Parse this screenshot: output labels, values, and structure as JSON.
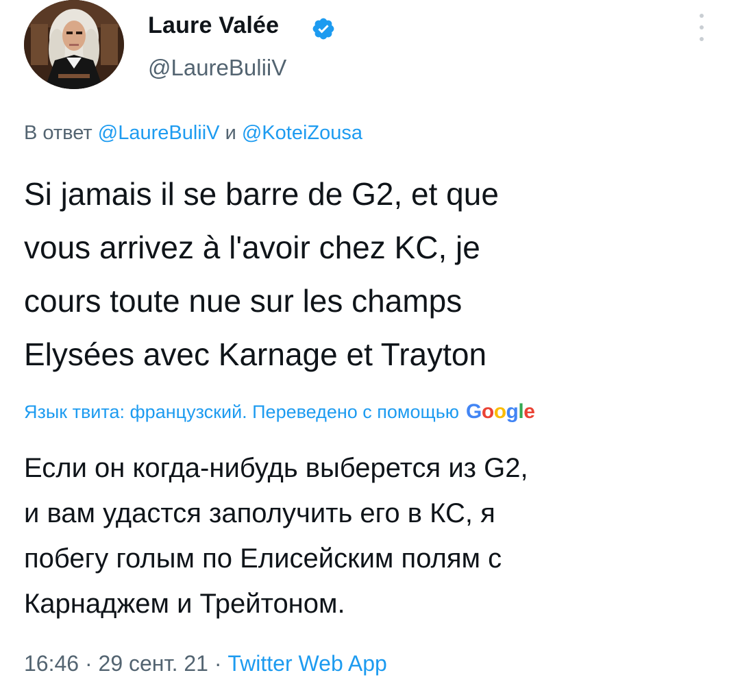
{
  "author": {
    "display_name": "Laure Valée",
    "username": "@LaureBuliiV",
    "verified": true,
    "avatar_icon": "profile-photo"
  },
  "reply_context": {
    "prefix": "В ответ",
    "mention_1": "@LaureBuliiV",
    "conjunction": "и",
    "mention_2": "@KoteiZousa"
  },
  "tweet_lines": [
    "Si jamais il se barre de G2, et que",
    "vous arrivez à l'avoir chez KC, je",
    "cours toute nue sur les champs",
    "Elysées avec Karnage et Trayton"
  ],
  "translation": {
    "label": "Язык твита: французский. Переведено с помощью",
    "provider": "Google",
    "lines": [
      "Если он когда-нибудь выберется из G2,",
      "и вам удастся заполучить его в КС, я",
      "побегу голым по Елисейским полям с",
      "Карнаджем и Трейтоном."
    ]
  },
  "meta": {
    "time": "16:46",
    "separator": "·",
    "date": "29 сент. 21",
    "source": "Twitter Web App"
  },
  "colors": {
    "text": "#0f1419",
    "muted": "#536471",
    "link": "#1d9bf0",
    "verified": "#1d9bf0"
  }
}
